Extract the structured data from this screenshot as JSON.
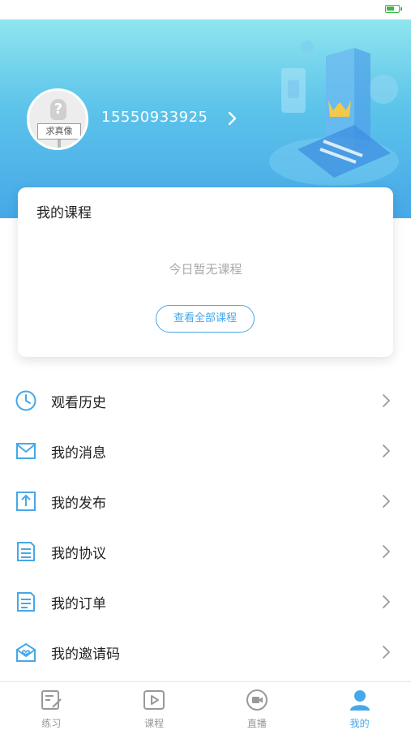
{
  "colors": {
    "accent": "#46a8e8",
    "header_top": "#8fe5ee",
    "header_bottom": "#46a8e8",
    "text": "#222222",
    "muted": "#aaaaaa"
  },
  "profile": {
    "avatar_sign": "求真像",
    "phone": "15550933925"
  },
  "course": {
    "title": "我的课程",
    "empty": "今日暂无课程",
    "view_all": "查看全部课程"
  },
  "menu": [
    {
      "icon": "clock-icon",
      "label": "观看历史"
    },
    {
      "icon": "mail-icon",
      "label": "我的消息"
    },
    {
      "icon": "upload-icon",
      "label": "我的发布"
    },
    {
      "icon": "document-icon",
      "label": "我的协议"
    },
    {
      "icon": "order-icon",
      "label": "我的订单"
    },
    {
      "icon": "invite-icon",
      "label": "我的邀请码"
    }
  ],
  "tabs": [
    {
      "icon": "practice-icon",
      "label": "练习",
      "active": false
    },
    {
      "icon": "play-icon",
      "label": "课程",
      "active": false
    },
    {
      "icon": "live-icon",
      "label": "直播",
      "active": false
    },
    {
      "icon": "user-icon",
      "label": "我的",
      "active": true
    }
  ]
}
